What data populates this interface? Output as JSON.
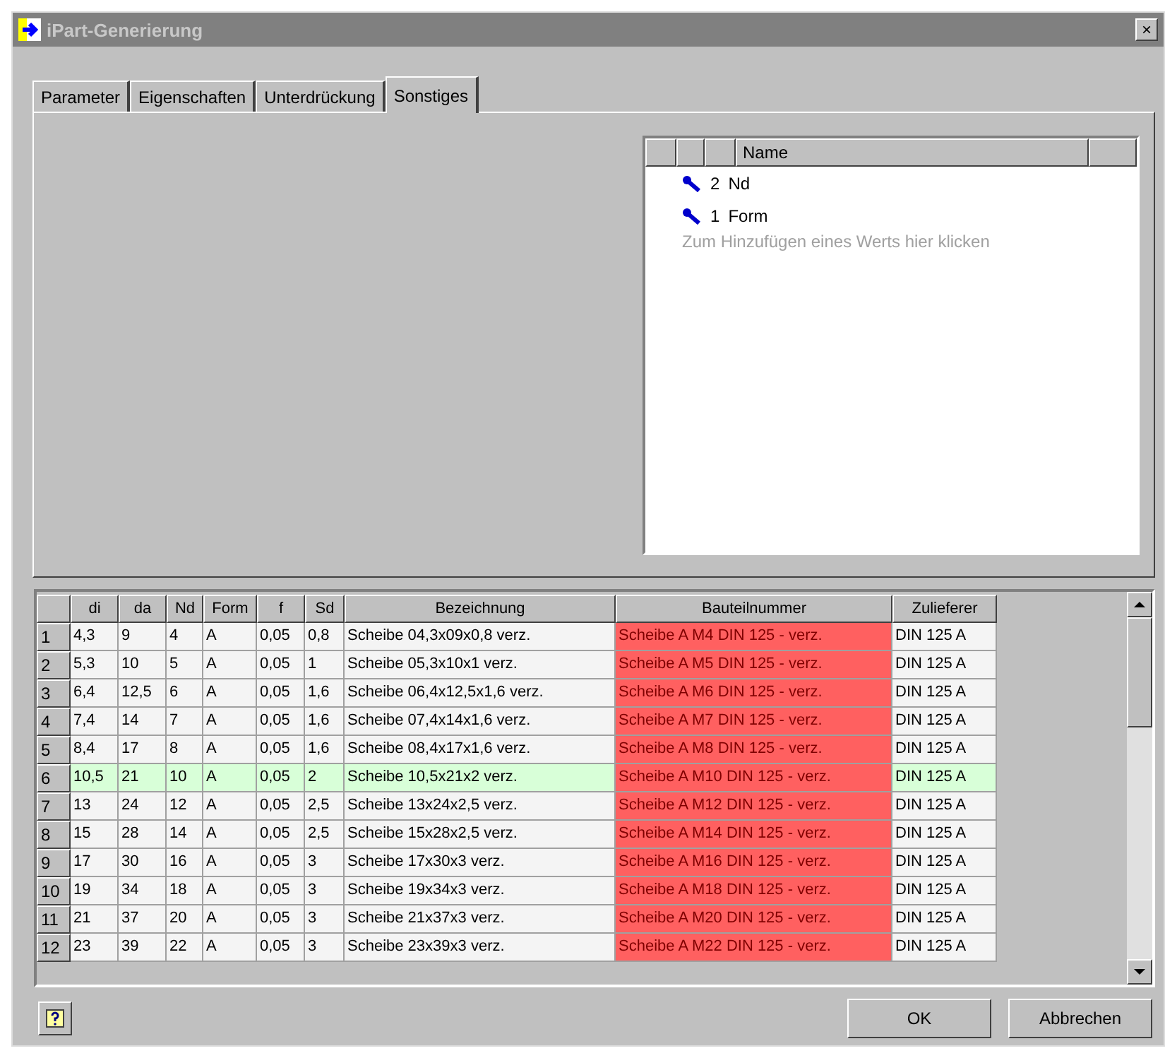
{
  "window": {
    "title": "iPart-Generierung",
    "close": "×"
  },
  "tabs": [
    {
      "label": "Parameter",
      "selected": false
    },
    {
      "label": "Eigenschaften",
      "selected": false
    },
    {
      "label": "Unterdrückung",
      "selected": false
    },
    {
      "label": "Sonstiges",
      "selected": true
    }
  ],
  "key_list": {
    "columns": [
      "Name"
    ],
    "items": [
      {
        "number": "2",
        "name": "Nd"
      },
      {
        "number": "1",
        "name": "Form"
      }
    ],
    "placeholder": "Zum Hinzufügen eines Werts hier klicken"
  },
  "table": {
    "columns": [
      {
        "label": "di",
        "highlight": false
      },
      {
        "label": "da",
        "highlight": false
      },
      {
        "label": "Nd",
        "highlight": false
      },
      {
        "label": "Form",
        "highlight": false
      },
      {
        "label": "f",
        "highlight": false
      },
      {
        "label": "Sd",
        "highlight": false
      },
      {
        "label": "Bezeichnung",
        "highlight": false
      },
      {
        "label": "Bauteilnummer",
        "highlight": true
      },
      {
        "label": "Zulieferer",
        "highlight": false
      }
    ],
    "rows": [
      {
        "index": "1",
        "selected": false,
        "cells": [
          "4,3",
          "9",
          "4",
          "A",
          "0,05",
          "0,8",
          "Scheibe 04,3x09x0,8 verz.",
          "Scheibe A M4 DIN 125 - verz.",
          "DIN 125 A"
        ]
      },
      {
        "index": "2",
        "selected": false,
        "cells": [
          "5,3",
          "10",
          "5",
          "A",
          "0,05",
          "1",
          "Scheibe 05,3x10x1 verz.",
          "Scheibe A M5 DIN 125 - verz.",
          "DIN 125 A"
        ]
      },
      {
        "index": "3",
        "selected": false,
        "cells": [
          "6,4",
          "12,5",
          "6",
          "A",
          "0,05",
          "1,6",
          "Scheibe 06,4x12,5x1,6 verz.",
          "Scheibe A M6 DIN 125 - verz.",
          "DIN 125 A"
        ]
      },
      {
        "index": "4",
        "selected": false,
        "cells": [
          "7,4",
          "14",
          "7",
          "A",
          "0,05",
          "1,6",
          "Scheibe 07,4x14x1,6 verz.",
          "Scheibe A M7 DIN 125 - verz.",
          "DIN 125 A"
        ]
      },
      {
        "index": "5",
        "selected": false,
        "cells": [
          "8,4",
          "17",
          "8",
          "A",
          "0,05",
          "1,6",
          "Scheibe 08,4x17x1,6 verz.",
          "Scheibe A M8 DIN 125 - verz.",
          "DIN 125 A"
        ]
      },
      {
        "index": "6",
        "selected": true,
        "cells": [
          "10,5",
          "21",
          "10",
          "A",
          "0,05",
          "2",
          "Scheibe 10,5x21x2 verz.",
          "Scheibe A M10 DIN 125 - verz.",
          "DIN 125 A"
        ]
      },
      {
        "index": "7",
        "selected": false,
        "cells": [
          "13",
          "24",
          "12",
          "A",
          "0,05",
          "2,5",
          "Scheibe 13x24x2,5 verz.",
          "Scheibe A M12 DIN 125 - verz.",
          "DIN 125 A"
        ]
      },
      {
        "index": "8",
        "selected": false,
        "cells": [
          "15",
          "28",
          "14",
          "A",
          "0,05",
          "2,5",
          "Scheibe 15x28x2,5 verz.",
          "Scheibe A M14 DIN 125 - verz.",
          "DIN 125 A"
        ]
      },
      {
        "index": "9",
        "selected": false,
        "cells": [
          "17",
          "30",
          "16",
          "A",
          "0,05",
          "3",
          "Scheibe 17x30x3 verz.",
          "Scheibe A M16 DIN 125 - verz.",
          "DIN 125 A"
        ]
      },
      {
        "index": "10",
        "selected": false,
        "cells": [
          "19",
          "34",
          "18",
          "A",
          "0,05",
          "3",
          "Scheibe 19x34x3 verz.",
          "Scheibe A M18 DIN 125 - verz.",
          "DIN 125 A"
        ]
      },
      {
        "index": "11",
        "selected": false,
        "cells": [
          "21",
          "37",
          "20",
          "A",
          "0,05",
          "3",
          "Scheibe 21x37x3 verz.",
          "Scheibe A M20 DIN 125 - verz.",
          "DIN 125 A"
        ]
      },
      {
        "index": "12",
        "selected": false,
        "cells": [
          "23",
          "39",
          "22",
          "A",
          "0,05",
          "3",
          "Scheibe 23x39x3 verz.",
          "Scheibe A M22 DIN 125 - verz.",
          "DIN 125 A"
        ]
      }
    ]
  },
  "buttons": [
    {
      "label": "OK"
    },
    {
      "label": "Abbrechen"
    }
  ]
}
